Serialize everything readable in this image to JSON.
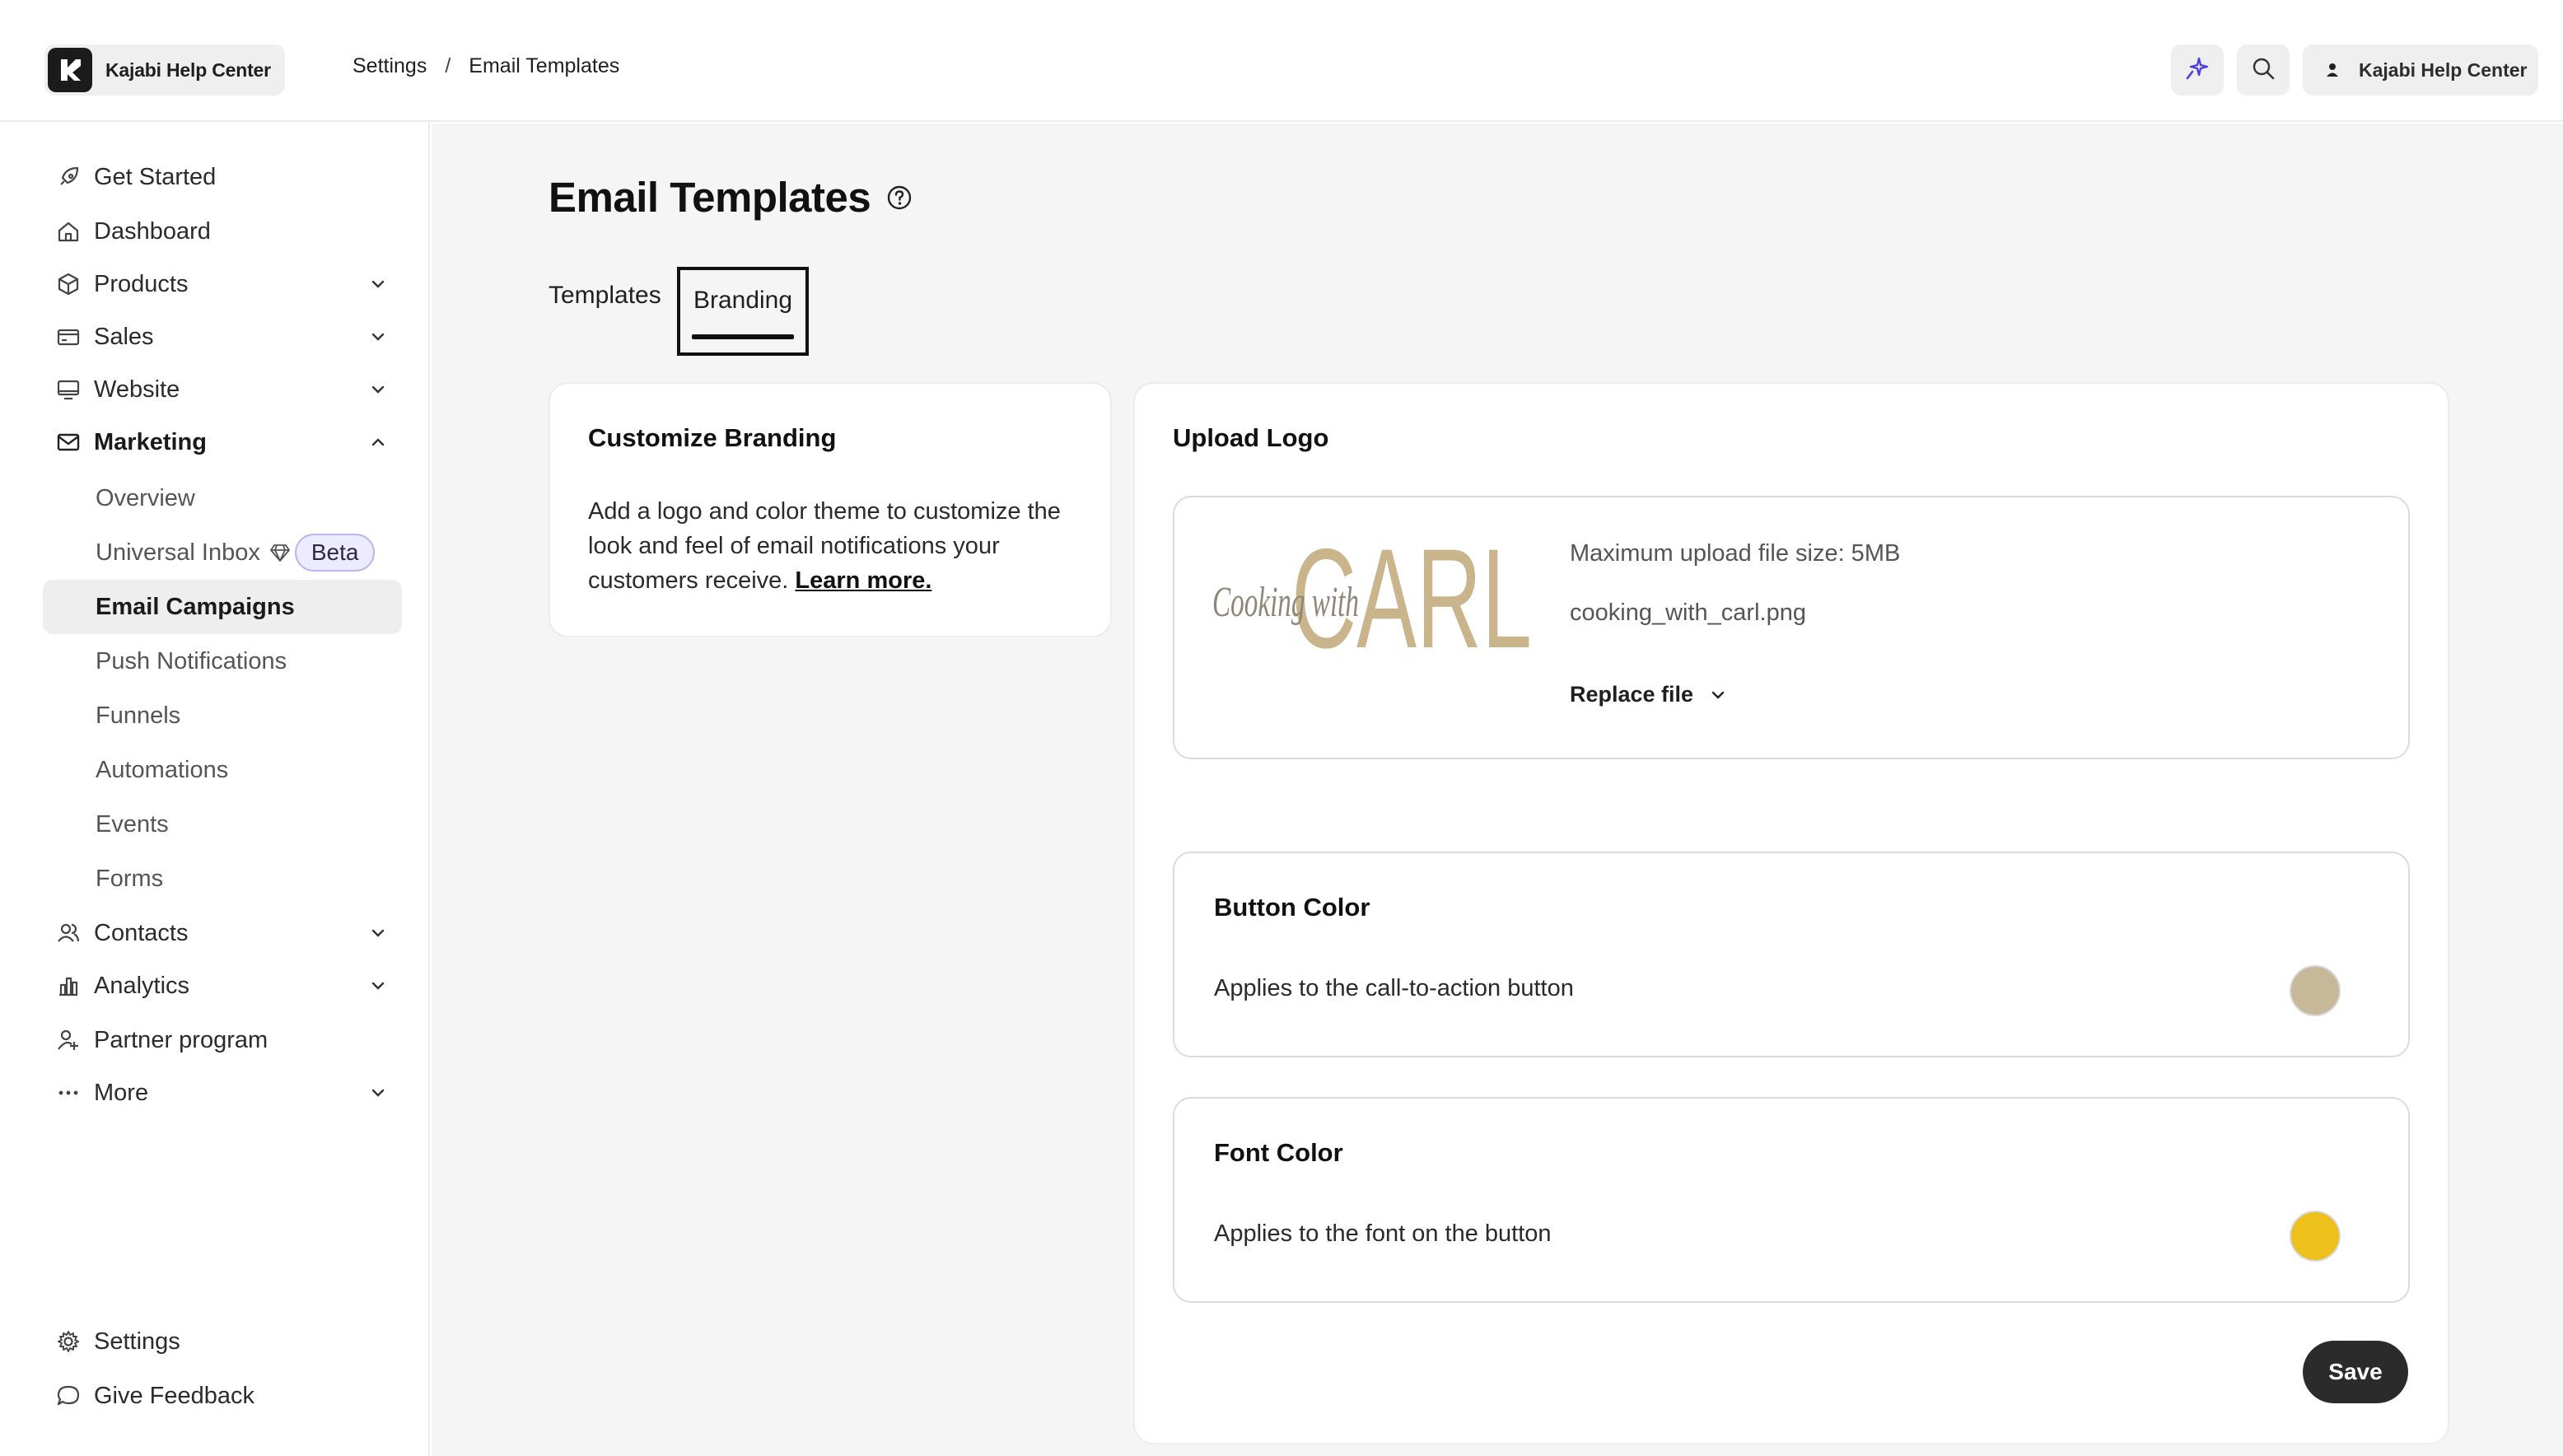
{
  "app": {
    "name": "Kajabi Help Center"
  },
  "breadcrumb": {
    "parent": "Settings",
    "separator": "/",
    "current": "Email Templates"
  },
  "header": {
    "account_label": "Kajabi Help Center"
  },
  "sidebar": {
    "items": [
      {
        "label": "Get Started",
        "icon": "rocket-icon"
      },
      {
        "label": "Dashboard",
        "icon": "home-icon"
      },
      {
        "label": "Products",
        "icon": "box-icon"
      },
      {
        "label": "Sales",
        "icon": "credit-card-icon"
      },
      {
        "label": "Website",
        "icon": "monitor-icon"
      },
      {
        "label": "Marketing",
        "icon": "mail-icon"
      },
      {
        "label": "Contacts",
        "icon": "users-icon"
      },
      {
        "label": "Analytics",
        "icon": "bar-chart-icon"
      },
      {
        "label": "Partner program",
        "icon": "user-plus-icon"
      },
      {
        "label": "More",
        "icon": "more-dots-icon"
      }
    ],
    "marketing_sub": [
      {
        "label": "Overview"
      },
      {
        "label": "Universal Inbox",
        "badge": "Beta"
      },
      {
        "label": "Email Campaigns",
        "active": true
      },
      {
        "label": "Push Notifications"
      },
      {
        "label": "Funnels"
      },
      {
        "label": "Automations"
      },
      {
        "label": "Events"
      },
      {
        "label": "Forms"
      }
    ],
    "bottom": [
      {
        "label": "Settings",
        "icon": "gear-icon"
      },
      {
        "label": "Give Feedback",
        "icon": "chat-bubble-icon"
      }
    ]
  },
  "main": {
    "title": "Email Templates",
    "tabs": [
      {
        "label": "Templates",
        "active": false
      },
      {
        "label": "Branding",
        "active": true
      }
    ],
    "customize": {
      "title": "Customize Branding",
      "text": "Add a logo and color theme to customize the look and feel of email notifications your customers receive.",
      "link": "Learn more."
    },
    "upload": {
      "title": "Upload Logo",
      "max_size": "Maximum upload file size: 5MB",
      "filename": "cooking_with_carl.png",
      "replace_label": "Replace file",
      "logo_script": "Cooking with",
      "logo_word": "CARL"
    },
    "button_color": {
      "title": "Button Color",
      "desc": "Applies to the call-to-action button",
      "color": "#c8b89a"
    },
    "font_color": {
      "title": "Font Color",
      "desc": "Applies to the font on the button",
      "color": "#eec01c"
    },
    "save_label": "Save"
  },
  "colors": {
    "accent_sparkle": "#4b3fe0",
    "sidebar_active_bg": "#eeeeee",
    "main_bg": "#f5f5f5",
    "save_bg": "#2b2b2b",
    "logo_gold": "#c9b48c"
  }
}
